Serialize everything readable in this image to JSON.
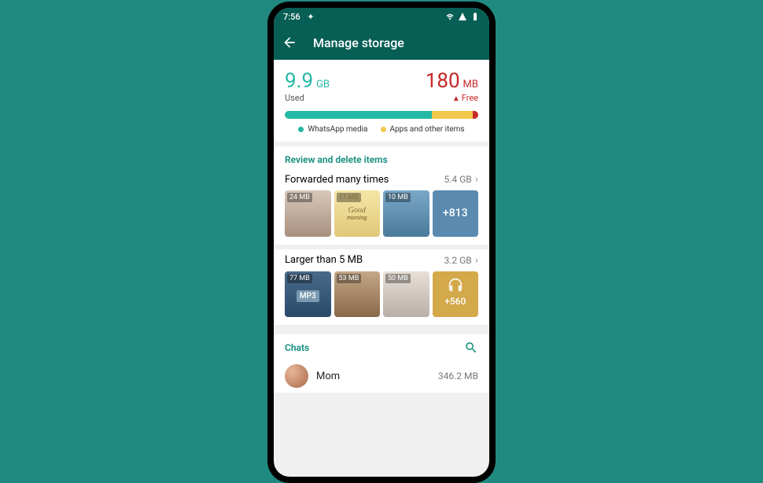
{
  "status": {
    "time": "7:56"
  },
  "appbar": {
    "title": "Manage storage"
  },
  "storage": {
    "used_value": "9.9",
    "used_unit": "GB",
    "used_label": "Used",
    "free_value": "180",
    "free_unit": "MB",
    "free_label": "Free",
    "legend_media": "WhatsApp media",
    "legend_apps": "Apps and other items"
  },
  "review": {
    "title": "Review and delete items"
  },
  "forwarded": {
    "title": "Forwarded many times",
    "size": "5.4 GB",
    "thumbs": [
      {
        "size": "24 MB"
      },
      {
        "size": "11 MB",
        "caption": "Good",
        "caption2": "morning"
      },
      {
        "size": "10 MB"
      },
      {
        "more": "+813"
      }
    ]
  },
  "larger": {
    "title": "Larger than 5 MB",
    "size": "3.2 GB",
    "thumbs": [
      {
        "size": "77 MB",
        "badge": "MP3"
      },
      {
        "size": "53 MB"
      },
      {
        "size": "50 MB"
      },
      {
        "more": "+560"
      }
    ]
  },
  "chats": {
    "title": "Chats",
    "items": [
      {
        "name": "Mom",
        "size": "346.2 MB"
      }
    ]
  }
}
